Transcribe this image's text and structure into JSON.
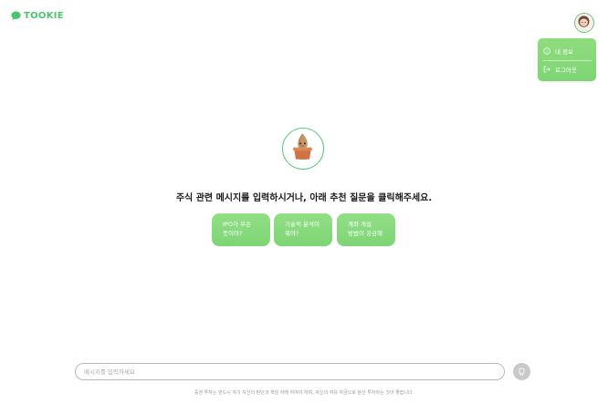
{
  "header": {
    "logo_text": "TOOKIE",
    "logo_icon": "chat-bubble-icon"
  },
  "user_menu": {
    "avatar_icon": "user-avatar",
    "items": [
      {
        "label": "내 정보",
        "icon": "info-icon"
      },
      {
        "label": "로그아웃",
        "icon": "logout-icon"
      }
    ]
  },
  "main": {
    "mascot": "sprout-pot-mascot",
    "prompt": "주식 관련 메시지를 입력하시거나, 아래 추천 질문을 클릭해주세요.",
    "suggestions": [
      {
        "line1": "IPO가 무슨",
        "line2": "뜻이야?"
      },
      {
        "line1": "기술적 분석이",
        "line2": "뭐야?"
      },
      {
        "line1": "계좌 개설",
        "line2": "방법이 궁금해"
      }
    ]
  },
  "chat": {
    "placeholder": "메시지를 입력하세요",
    "value": "",
    "send_icon": "send-icon"
  },
  "footer": {
    "disclaimer": "증권 투자는 반드시 자기 자신의 판단과 책임 하에 하여야 하며, 자신의 여유 자금으로 분산 투자하는 것이 좋습니다."
  },
  "colors": {
    "brand_green": "#4cc571",
    "button_green": "#86d87c",
    "send_button_gray": "#c9c9c9",
    "input_border": "#b9b9b9"
  }
}
